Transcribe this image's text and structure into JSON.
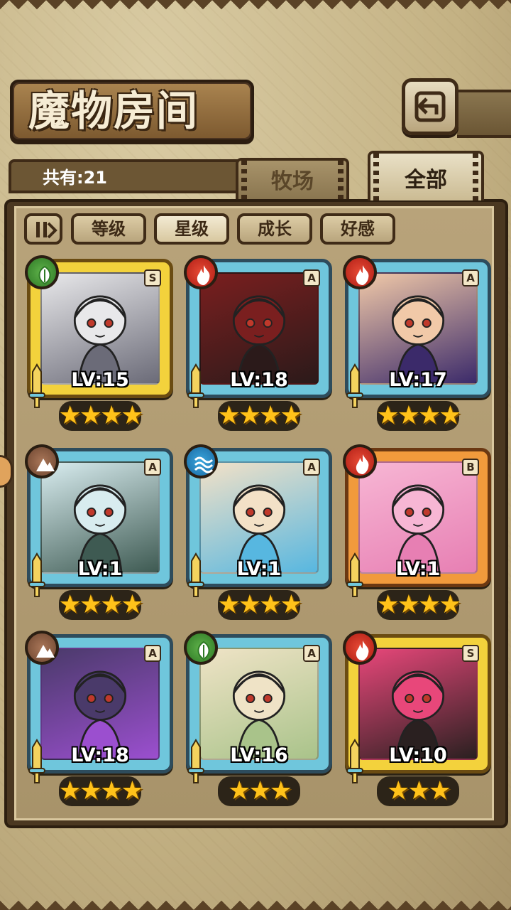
{
  "title": "魔物房间",
  "count_label": "共有:21",
  "main_tabs": [
    {
      "label": "牧场",
      "active": false
    },
    {
      "label": "全部",
      "active": true
    }
  ],
  "filters": [
    {
      "label": "等级",
      "active": false
    },
    {
      "label": "星级",
      "active": true
    },
    {
      "label": "成长",
      "active": false
    },
    {
      "label": "好感",
      "active": false
    }
  ],
  "monsters": [
    {
      "level": "LV:15",
      "rank": "S",
      "element": "wood-icon",
      "stars": "★★★★",
      "star_count": 4,
      "frame": "gold"
    },
    {
      "level": "LV:18",
      "rank": "A",
      "element": "fire-icon",
      "stars": "★★★★",
      "star_count": 4,
      "frame": "blue"
    },
    {
      "level": "LV:17",
      "rank": "A",
      "element": "fire-icon",
      "stars": "★★★★",
      "star_count": 4,
      "frame": "blue"
    },
    {
      "level": "LV:1",
      "rank": "A",
      "element": "earth-icon",
      "stars": "★★★★",
      "star_count": 4,
      "frame": "blue"
    },
    {
      "level": "LV:1",
      "rank": "A",
      "element": "water-icon",
      "stars": "★★★★",
      "star_count": 4,
      "frame": "blue"
    },
    {
      "level": "LV:1",
      "rank": "B",
      "element": "fire-icon",
      "stars": "★★★★",
      "star_count": 4,
      "frame": "orange"
    },
    {
      "level": "LV:18",
      "rank": "A",
      "element": "earth-icon",
      "stars": "★★★★",
      "star_count": 4,
      "frame": "blue"
    },
    {
      "level": "LV:16",
      "rank": "A",
      "element": "wood-icon",
      "stars": "★★★",
      "star_count": 3,
      "frame": "blue"
    },
    {
      "level": "LV:10",
      "rank": "S",
      "element": "fire-icon",
      "stars": "★★★",
      "star_count": 3,
      "frame": "gold"
    }
  ],
  "colors": {
    "frame_gold": "#f3d23c",
    "frame_blue": "#6fc6dc",
    "frame_orange": "#f19a3c",
    "star": "#ffc21a"
  }
}
